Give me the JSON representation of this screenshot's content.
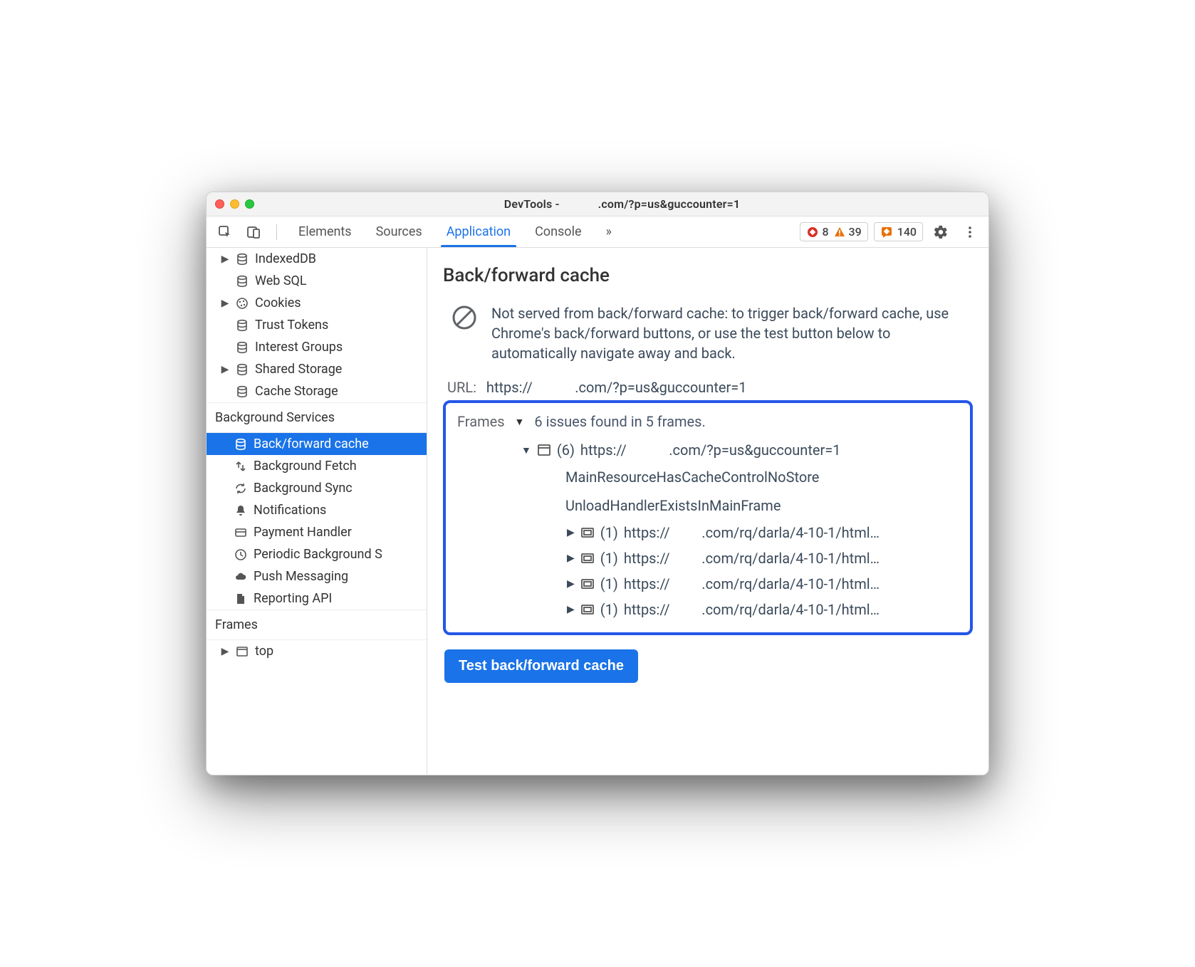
{
  "window": {
    "title_left": "DevTools - ",
    "title_right": ".com/?p=us&guccounter=1"
  },
  "toolbar": {
    "tabs": [
      "Elements",
      "Sources",
      "Application",
      "Console"
    ],
    "active_tab": 2,
    "overflow": "»",
    "errors_count": "8",
    "warnings_count": "39",
    "issues_count": "140"
  },
  "sidebar": {
    "storage": [
      {
        "label": "IndexedDB",
        "icon": "db",
        "expandable": true
      },
      {
        "label": "Web SQL",
        "icon": "db",
        "expandable": false
      },
      {
        "label": "Cookies",
        "icon": "cookie",
        "expandable": true
      },
      {
        "label": "Trust Tokens",
        "icon": "db",
        "expandable": false
      },
      {
        "label": "Interest Groups",
        "icon": "db",
        "expandable": false
      },
      {
        "label": "Shared Storage",
        "icon": "db",
        "expandable": true
      },
      {
        "label": "Cache Storage",
        "icon": "db",
        "expandable": false
      }
    ],
    "bg_services_title": "Background Services",
    "bg_services": [
      {
        "label": "Back/forward cache",
        "icon": "db",
        "selected": true
      },
      {
        "label": "Background Fetch",
        "icon": "fetch"
      },
      {
        "label": "Background Sync",
        "icon": "sync"
      },
      {
        "label": "Notifications",
        "icon": "bell"
      },
      {
        "label": "Payment Handler",
        "icon": "card"
      },
      {
        "label": "Periodic Background S",
        "icon": "clock"
      },
      {
        "label": "Push Messaging",
        "icon": "cloud"
      },
      {
        "label": "Reporting API",
        "icon": "doc"
      }
    ],
    "frames_title": "Frames",
    "frames": [
      {
        "label": "top",
        "icon": "frame",
        "expandable": true
      }
    ]
  },
  "main": {
    "heading": "Back/forward cache",
    "info_text": "Not served from back/forward cache: to trigger back/forward cache, use Chrome's back/forward buttons, or use the test button below to automatically navigate away and back.",
    "url_label": "URL:",
    "url_value": "https://            .com/?p=us&guccounter=1",
    "frames_label": "Frames",
    "frames_summary": "6 issues found in 5 frames.",
    "frame_main": {
      "count": "(6)",
      "url": "https://            .com/?p=us&guccounter=1",
      "reasons": [
        "MainResourceHasCacheControlNoStore",
        "UnloadHandlerExistsInMainFrame"
      ]
    },
    "subframes": [
      {
        "count": "(1)",
        "url": "https://         .com/rq/darla/4-10-1/html…"
      },
      {
        "count": "(1)",
        "url": "https://         .com/rq/darla/4-10-1/html…"
      },
      {
        "count": "(1)",
        "url": "https://         .com/rq/darla/4-10-1/html…"
      },
      {
        "count": "(1)",
        "url": "https://         .com/rq/darla/4-10-1/html…"
      }
    ],
    "test_button": "Test back/forward cache"
  }
}
